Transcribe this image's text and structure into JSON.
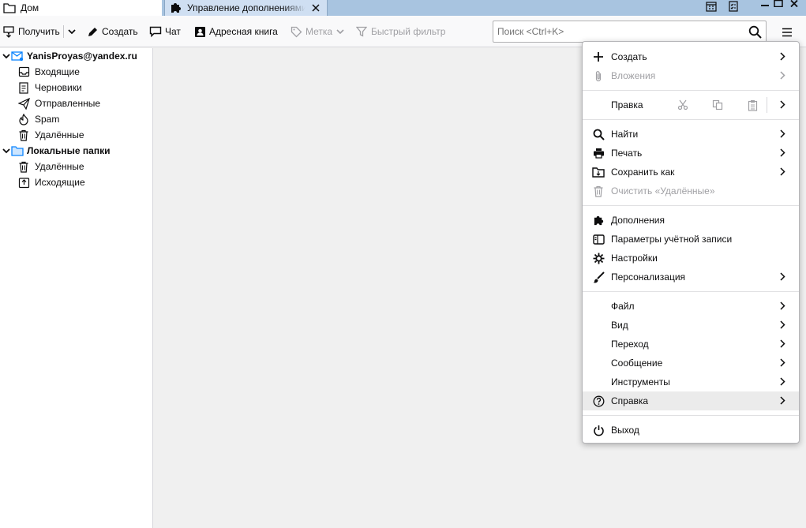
{
  "tabs": [
    {
      "label": "Дом",
      "icon": "folder-icon"
    },
    {
      "label": "Управление дополнениями",
      "icon": "puzzle-icon"
    }
  ],
  "toolbar": {
    "get_messages": "Получить",
    "write": "Создать",
    "chat": "Чат",
    "address_book": "Адресная книга",
    "tag": "Метка",
    "quick_filter": "Быстрый фильтр"
  },
  "search": {
    "placeholder": "Поиск <Ctrl+K>"
  },
  "folders": {
    "account": "YanisProyas@yandex.ru",
    "inbox": "Входящие",
    "drafts": "Черновики",
    "sent": "Отправленные",
    "spam": "Spam",
    "trash": "Удалённые",
    "local": "Локальные папки",
    "local_trash": "Удалённые",
    "outbox": "Исходящие"
  },
  "menu": {
    "new": "Создать",
    "attachments": "Вложения",
    "edit": "Правка",
    "find": "Найти",
    "print": "Печать",
    "save_as": "Сохранить как",
    "empty_trash": "Очистить «Удалённые»",
    "addons": "Дополнения",
    "account_settings": "Параметры учётной записи",
    "preferences": "Настройки",
    "customize": "Персонализация",
    "file": "Файл",
    "view": "Вид",
    "go": "Переход",
    "message": "Сообщение",
    "tools": "Инструменты",
    "help": "Справка",
    "quit": "Выход"
  },
  "colors": {
    "accent": "#0a84ff",
    "titlebar": "#a8c4e0",
    "menu_highlight": "#ebebeb"
  }
}
